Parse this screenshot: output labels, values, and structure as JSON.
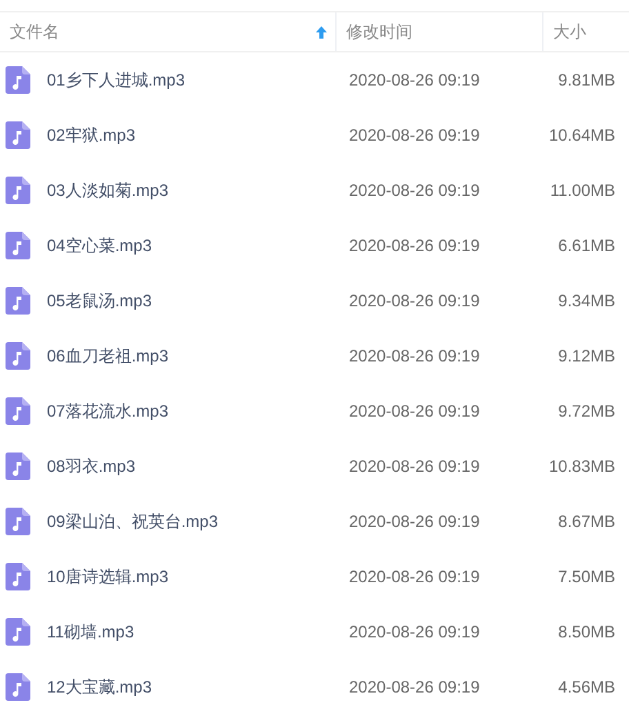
{
  "table": {
    "columns": [
      {
        "label": "文件名",
        "sorted": true
      },
      {
        "label": "修改时间",
        "sorted": false
      },
      {
        "label": "大小",
        "sorted": false
      }
    ],
    "rows": [
      {
        "name": "01乡下人进城.mp3",
        "modified": "2020-08-26 09:19",
        "size": "9.81MB"
      },
      {
        "name": "02牢狱.mp3",
        "modified": "2020-08-26 09:19",
        "size": "10.64MB"
      },
      {
        "name": "03人淡如菊.mp3",
        "modified": "2020-08-26 09:19",
        "size": "11.00MB"
      },
      {
        "name": "04空心菜.mp3",
        "modified": "2020-08-26 09:19",
        "size": "6.61MB"
      },
      {
        "name": "05老鼠汤.mp3",
        "modified": "2020-08-26 09:19",
        "size": "9.34MB"
      },
      {
        "name": "06血刀老祖.mp3",
        "modified": "2020-08-26 09:19",
        "size": "9.12MB"
      },
      {
        "name": "07落花流水.mp3",
        "modified": "2020-08-26 09:19",
        "size": "9.72MB"
      },
      {
        "name": "08羽衣.mp3",
        "modified": "2020-08-26 09:19",
        "size": "10.83MB"
      },
      {
        "name": "09梁山泊、祝英台.mp3",
        "modified": "2020-08-26 09:19",
        "size": "8.67MB"
      },
      {
        "name": "10唐诗选辑.mp3",
        "modified": "2020-08-26 09:19",
        "size": "7.50MB"
      },
      {
        "name": "11砌墙.mp3",
        "modified": "2020-08-26 09:19",
        "size": "8.50MB"
      },
      {
        "name": "12大宝藏.mp3",
        "modified": "2020-08-26 09:19",
        "size": "4.56MB"
      }
    ]
  }
}
